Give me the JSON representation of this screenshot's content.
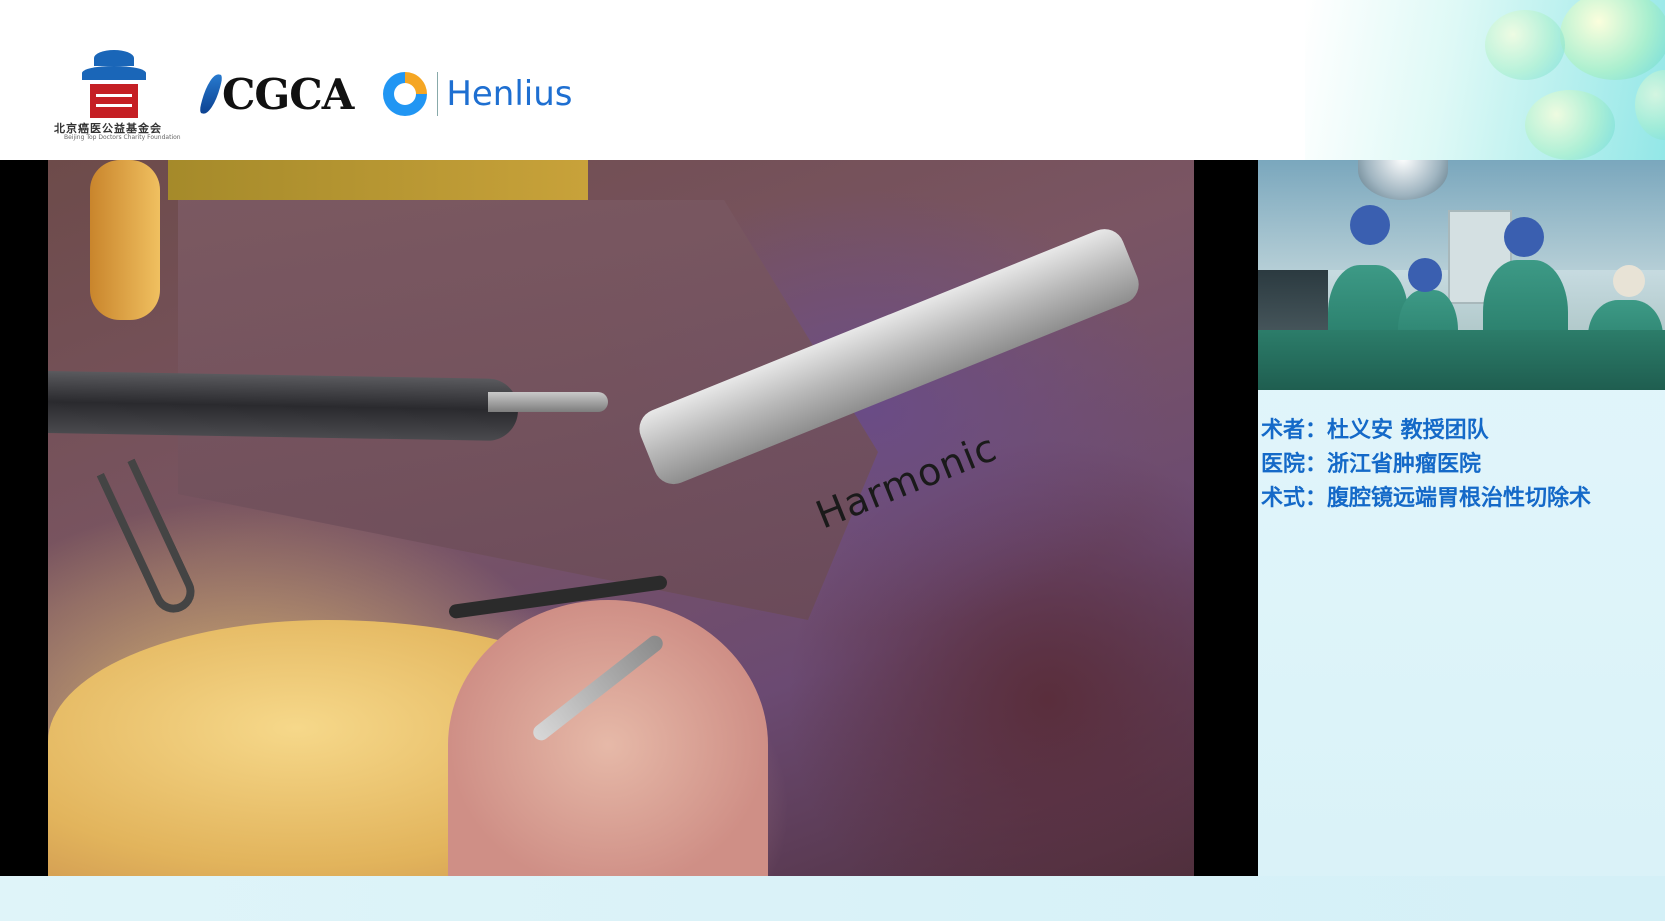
{
  "header": {
    "logos": [
      {
        "name": "beijing-top-doctors-charity-foundation",
        "cn_text": "北京癌医公益基金会",
        "en_text": "Beijing Top Doctors Charity Foundation"
      },
      {
        "name": "cgca",
        "text": "CGCA"
      },
      {
        "name": "henlius",
        "text": "Henlius"
      }
    ]
  },
  "video": {
    "instrument_label": "Harmonic"
  },
  "info": {
    "surgeon": "术者：杜义安 教授团队",
    "hospital": "医院：浙江省肿瘤医院",
    "procedure": "术式：腹腔镜远端胃根治性切除术"
  },
  "colors": {
    "info_text": "#1469c8",
    "background": "#e4f6fb",
    "cgca_blue": "#0a3d8c",
    "henlius_blue": "#1e6fd1",
    "foundation_red": "#c51f24"
  }
}
